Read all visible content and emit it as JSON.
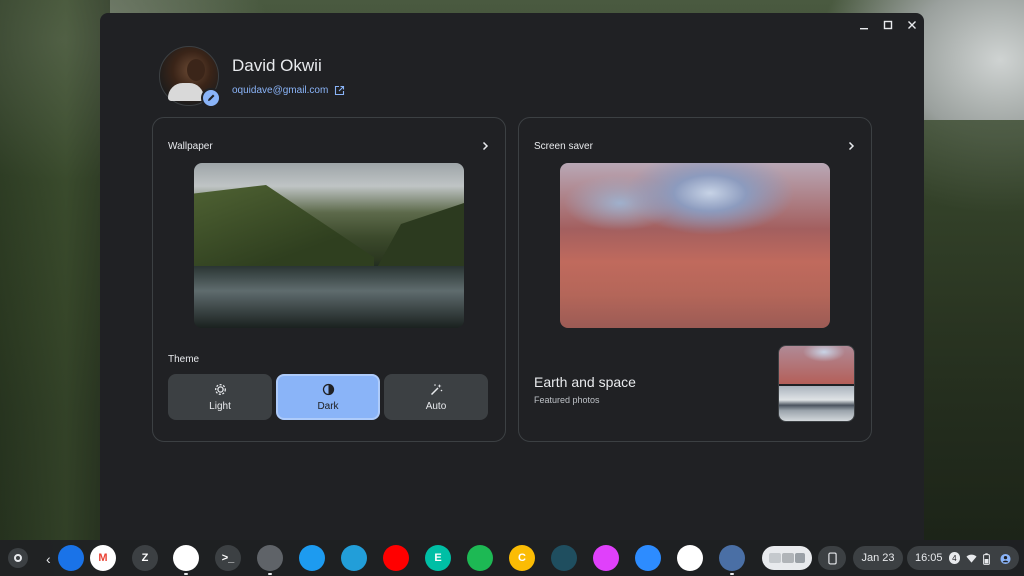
{
  "profile": {
    "name": "David Okwii",
    "email": "oquidave@gmail.com"
  },
  "wallpaper": {
    "title": "Wallpaper",
    "theme_label": "Theme",
    "theme_options": [
      {
        "label": "Light",
        "icon": "sun-gear-icon",
        "selected": false
      },
      {
        "label": "Dark",
        "icon": "half-circle-icon",
        "selected": true
      },
      {
        "label": "Auto",
        "icon": "magic-wand-icon",
        "selected": false
      }
    ]
  },
  "screensaver": {
    "title": "Screen saver",
    "collection_title": "Earth and space",
    "collection_subtitle": "Featured photos"
  },
  "shelf": {
    "apps": [
      {
        "name": "app-partial",
        "letter": "",
        "color": "#1a73e8"
      },
      {
        "name": "gmail",
        "letter": "M",
        "color": "#ffffff"
      },
      {
        "name": "z-app",
        "letter": "Z",
        "color": "#3c4043"
      },
      {
        "name": "google-drive",
        "letter": "",
        "color": "#ffffff"
      },
      {
        "name": "terminal",
        "letter": ">_",
        "color": "#3c4043"
      },
      {
        "name": "settings",
        "letter": "",
        "color": "#5f6368"
      },
      {
        "name": "twitter",
        "letter": "",
        "color": "#1d9bf0"
      },
      {
        "name": "telegram",
        "letter": "",
        "color": "#229ed9"
      },
      {
        "name": "youtube",
        "letter": "",
        "color": "#ff0000"
      },
      {
        "name": "e-app",
        "letter": "E",
        "color": "#00bfa5"
      },
      {
        "name": "spotify",
        "letter": "",
        "color": "#1db954"
      },
      {
        "name": "c-app",
        "letter": "C",
        "color": "#fbbc04"
      },
      {
        "name": "screen-app",
        "letter": "",
        "color": "#1f4e5f"
      },
      {
        "name": "gallery",
        "letter": "",
        "color": "#e040fb"
      },
      {
        "name": "zoom",
        "letter": "",
        "color": "#2d8cff"
      },
      {
        "name": "play-store",
        "letter": "",
        "color": "#ffffff"
      },
      {
        "name": "wallpaper-app",
        "letter": "",
        "color": "#4a6fa5"
      }
    ],
    "date": "Jan 23",
    "time": "16:05",
    "notification_count": "4"
  },
  "colors": {
    "accent": "#8ab4f8",
    "window_bg": "#202124",
    "button_bg": "#3c4043"
  }
}
